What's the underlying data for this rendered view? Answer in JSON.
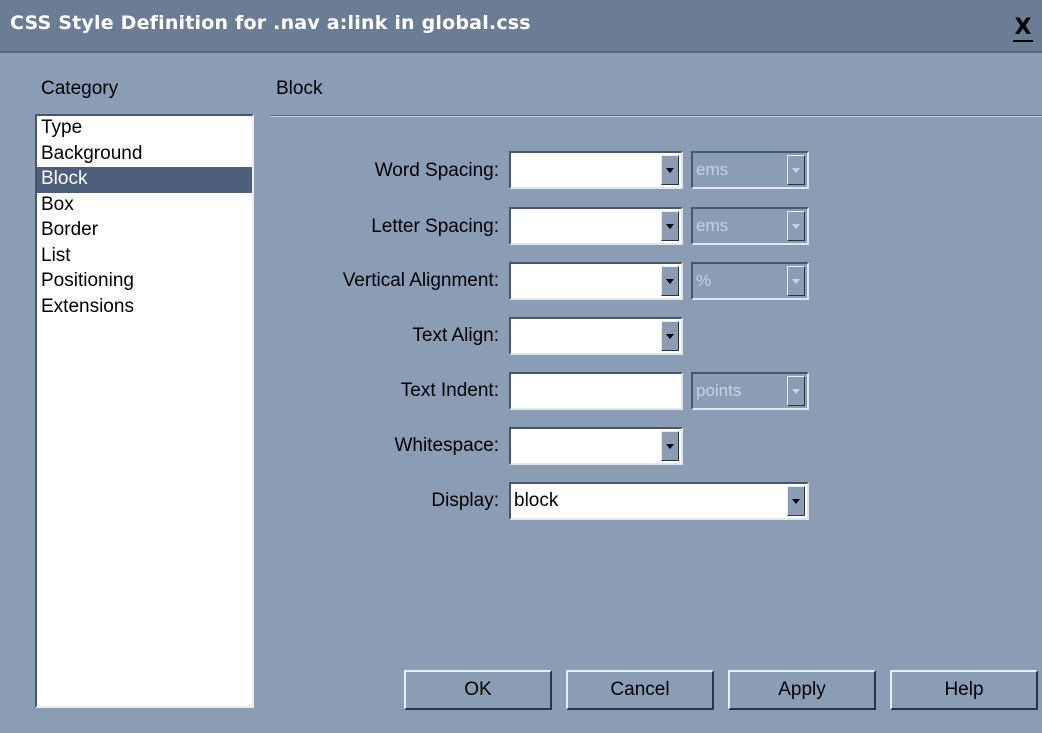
{
  "window": {
    "title": "CSS Style Definition for .nav a:link in global.css",
    "close_label": "X"
  },
  "category": {
    "label": "Category",
    "items": [
      "Type",
      "Background",
      "Block",
      "Box",
      "Border",
      "List",
      "Positioning",
      "Extensions"
    ],
    "selected": "Block"
  },
  "panel": {
    "title": "Block",
    "fields": {
      "word_spacing": {
        "label": "Word Spacing:",
        "value": "",
        "unit": "ems"
      },
      "letter_spacing": {
        "label": "Letter Spacing:",
        "value": "",
        "unit": "ems"
      },
      "vertical_alignment": {
        "label": "Vertical Alignment:",
        "value": "",
        "unit": "%"
      },
      "text_align": {
        "label": "Text Align:",
        "value": ""
      },
      "text_indent": {
        "label": "Text Indent:",
        "value": "",
        "unit": "points"
      },
      "whitespace": {
        "label": "Whitespace:",
        "value": ""
      },
      "display": {
        "label": "Display:",
        "value": "block"
      }
    }
  },
  "buttons": {
    "ok": "OK",
    "cancel": "Cancel",
    "apply": "Apply",
    "help": "Help"
  },
  "colors": {
    "background": "#8a9db5",
    "titlebar": "#6b7d94",
    "selection": "#4d5f7a"
  }
}
